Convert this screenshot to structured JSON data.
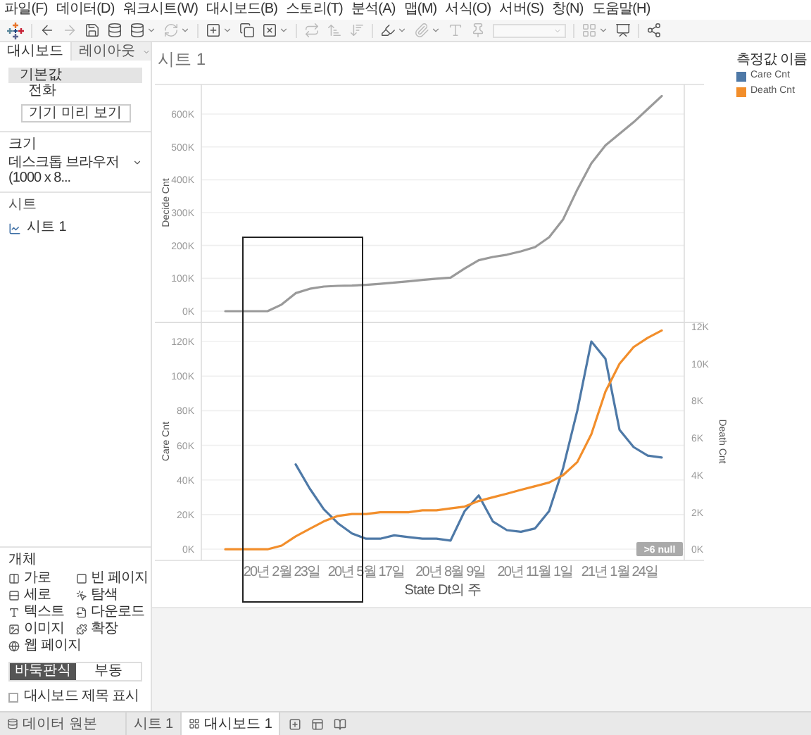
{
  "menu": [
    "파일(F)",
    "데이터(D)",
    "워크시트(W)",
    "대시보드(B)",
    "스토리(T)",
    "분석(A)",
    "맵(M)",
    "서식(O)",
    "서버(S)",
    "창(N)",
    "도움말(H)"
  ],
  "side_panel": {
    "tabs": [
      {
        "label": "대시보드",
        "selected": true
      },
      {
        "label": "레이아웃",
        "selected": false
      }
    ],
    "devices": [
      {
        "label": "기본값",
        "selected": true
      },
      {
        "label": "전화",
        "selected": false
      }
    ],
    "device_preview_button": "기기 미리 보기",
    "size": {
      "heading": "크기",
      "value": "데스크톱 브라우저(1000 x 8..."
    },
    "sheets": {
      "heading": "시트",
      "items": [
        "시트 1"
      ]
    },
    "objects": {
      "heading": "개체",
      "items": [
        {
          "label": "가로",
          "kind": "horizontal"
        },
        {
          "label": "빈 페이지",
          "kind": "blank"
        },
        {
          "label": "세로",
          "kind": "vertical"
        },
        {
          "label": "탐색",
          "kind": "navigation"
        },
        {
          "label": "텍스트",
          "kind": "text"
        },
        {
          "label": "다운로드",
          "kind": "download"
        },
        {
          "label": "이미지",
          "kind": "image"
        },
        {
          "label": "확장",
          "kind": "extension"
        },
        {
          "label": "웹 페이지",
          "kind": "web"
        }
      ]
    },
    "layout_mode": [
      {
        "label": "바둑판식",
        "selected": true
      },
      {
        "label": "부동",
        "selected": false
      }
    ],
    "show_title": {
      "label": "대시보드 제목 표시",
      "checked": false
    }
  },
  "sheet": {
    "title": "시트 1",
    "legend": {
      "title": "측정값 이름",
      "items": [
        {
          "label": "Care Cnt",
          "color": "#4e79a7"
        },
        {
          "label": "Death Cnt",
          "color": "#f28e2b"
        }
      ]
    },
    "top_chart": {
      "chart_data": {
        "type": "line",
        "ylabel": "Decide Cnt",
        "grid": true,
        "ylim": [
          -30000,
          690000
        ],
        "series": [
          {
            "color": "#9a9a9a",
            "values": [
              0,
              0,
              0,
              0,
              20000,
              55000,
              68000,
              75000,
              77000,
              78000,
              80000,
              83000,
              87000,
              91000,
              95000,
              99000,
              102000,
              130000,
              155000,
              165000,
              172000,
              182000,
              195000,
              225000,
              280000,
              370000,
              450000,
              505000,
              540000,
              575000,
              615000,
              655000
            ]
          }
        ],
        "yticks": [
          {
            "value": 600000,
            "label": "600K"
          },
          {
            "value": 500000,
            "label": "500K"
          },
          {
            "value": 400000,
            "label": "400K"
          },
          {
            "value": 300000,
            "label": "300K"
          },
          {
            "value": 200000,
            "label": "200K"
          },
          {
            "value": 100000,
            "label": "100K"
          },
          {
            "value": 0,
            "label": "0K"
          }
        ]
      }
    },
    "bottom_chart": {
      "chart_data": {
        "type": "line",
        "xlabel": "State Dt의 주",
        "ylabel": "Care Cnt",
        "grid": true,
        "categories": [
          null,
          null,
          null,
          null,
          "20년 2월 23일",
          null,
          null,
          null,
          null,
          null,
          "20년 5월 17일",
          null,
          null,
          null,
          null,
          null,
          "20년 8월 9일",
          null,
          null,
          null,
          null,
          null,
          "20년 11월 1일",
          null,
          null,
          null,
          null,
          null,
          "21년 1월 24일",
          null,
          null,
          null
        ],
        "ylim": [
          -6500,
          131000
        ],
        "series": [
          {
            "color": "#4e79a7",
            "values": [
              null,
              null,
              null,
              null,
              null,
              49000,
              35000,
              23000,
              15000,
              9000,
              6000,
              6000,
              8000,
              7000,
              6000,
              6000,
              5000,
              22000,
              31000,
              16000,
              11000,
              10000,
              12000,
              22000,
              47000,
              80000,
              120000,
              110000,
              69000,
              59000,
              54000,
              53000
            ]
          }
        ],
        "yticks": [
          {
            "value": 120000,
            "label": "120K"
          },
          {
            "value": 100000,
            "label": "100K"
          },
          {
            "value": 80000,
            "label": "80K"
          },
          {
            "value": 60000,
            "label": "60K"
          },
          {
            "value": 40000,
            "label": "40K"
          },
          {
            "value": 20000,
            "label": "20K"
          },
          {
            "value": 0,
            "label": "0K"
          }
        ],
        "annotations": [
          ">6 null"
        ]
      }
    },
    "right_axis_chart": {
      "chart_data": {
        "type": "line",
        "ylabel": "Death Cnt",
        "ylim": [
          -600,
          12230
        ],
        "series": [
          {
            "color": "#f28e2b",
            "values": [
              0,
              0,
              0,
              0,
              200,
              700,
              1100,
              1500,
              1800,
              1900,
              1900,
              2000,
              2000,
              2000,
              2100,
              2100,
              2200,
              2300,
              2600,
              2800,
              3000,
              3200,
              3400,
              3600,
              4000,
              4700,
              6200,
              8500,
              10000,
              10900,
              11400,
              11800
            ]
          }
        ],
        "yticks": [
          {
            "value": 12000,
            "label": "12K"
          },
          {
            "value": 10000,
            "label": "10K"
          },
          {
            "value": 8000,
            "label": "8K"
          },
          {
            "value": 6000,
            "label": "6K"
          },
          {
            "value": 4000,
            "label": "4K"
          },
          {
            "value": 2000,
            "label": "2K"
          },
          {
            "value": 0,
            "label": "0K"
          }
        ]
      }
    }
  },
  "bottom_tabs": [
    {
      "label": "데이터 원본",
      "kind": "datasource",
      "selected": false
    },
    {
      "label": "시트 1",
      "kind": "sheet",
      "selected": false
    },
    {
      "label": "대시보드 1",
      "kind": "dashboard",
      "selected": true
    }
  ]
}
